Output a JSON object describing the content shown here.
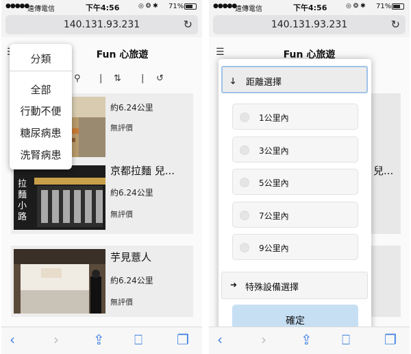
{
  "status_bar": {
    "signal": "●●●●●",
    "carrier": "遠傳電信",
    "time": "下午4:56",
    "battery_pct": "71%"
  },
  "browser": {
    "url": "140.131.93.231"
  },
  "app": {
    "title": "Fun 心旅遊"
  },
  "left_screen": {
    "category_menu": {
      "header": "分類",
      "items": [
        "全部",
        "行動不便",
        "糖尿病患",
        "洗腎病患"
      ]
    },
    "list": [
      {
        "name": "",
        "distance": "約6.24公里",
        "rating": "無評價"
      },
      {
        "name": "京都拉麵 兒...",
        "distance": "約6.24公里",
        "rating": "無評價",
        "sign_text": "拉麵小路"
      },
      {
        "name": "芋見薏人",
        "distance": "約6.24公里",
        "rating": "無評價"
      }
    ]
  },
  "right_screen": {
    "background_item_name": "兒...",
    "distance_section": {
      "label": "距離選擇",
      "arrow": "down"
    },
    "distance_options": [
      "1公里內",
      "3公里內",
      "5公里內",
      "7公里內",
      "9公里內"
    ],
    "facility_section": {
      "label": "特殊設備選擇",
      "arrow": "right"
    },
    "confirm_label": "確定"
  },
  "bottom_toolbar": {
    "icons": [
      "back-icon",
      "forward-icon",
      "share-icon",
      "bookmarks-icon",
      "tabs-icon"
    ]
  },
  "colors": {
    "accent_blue": "#3d7fe0",
    "confirm_button": "#c7dff3",
    "active_border": "#9ec3e6"
  }
}
